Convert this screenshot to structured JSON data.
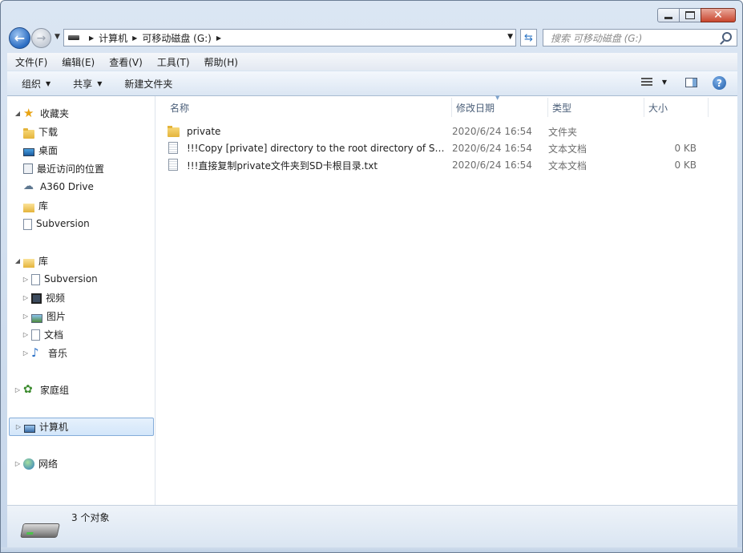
{
  "window": {
    "close_glyph": "✕"
  },
  "address": {
    "crumbs": [
      "计算机",
      "可移动磁盘 (G:)"
    ],
    "search_placeholder": "搜索 可移动磁盘 (G:)"
  },
  "menu": [
    "文件(F)",
    "编辑(E)",
    "查看(V)",
    "工具(T)",
    "帮助(H)"
  ],
  "commands": {
    "organize": "组织",
    "share": "共享",
    "new_folder": "新建文件夹"
  },
  "nav": {
    "favorites": {
      "label": "收藏夹",
      "items": [
        "下载",
        "桌面",
        "最近访问的位置",
        "A360 Drive",
        "库",
        "Subversion"
      ]
    },
    "libraries": {
      "label": "库",
      "items": [
        "Subversion",
        "视频",
        "图片",
        "文档",
        "音乐"
      ]
    },
    "homegroup": "家庭组",
    "computer": "计算机",
    "network": "网络"
  },
  "columns": {
    "name": "名称",
    "date": "修改日期",
    "type": "类型",
    "size": "大小"
  },
  "files": [
    {
      "name": "private",
      "date": "2020/6/24 16:54",
      "type": "文件夹",
      "size": "",
      "icon": "folder-icon"
    },
    {
      "name": "!!!Copy [private] directory to the root directory of  SD…",
      "date": "2020/6/24 16:54",
      "type": "文本文档",
      "size": "0 KB",
      "icon": "text-file-icon"
    },
    {
      "name": "!!!直接复制private文件夹到SD卡根目录.txt",
      "date": "2020/6/24 16:54",
      "type": "文本文档",
      "size": "0 KB",
      "icon": "text-file-icon"
    }
  ],
  "status": {
    "count": "3 个对象"
  }
}
